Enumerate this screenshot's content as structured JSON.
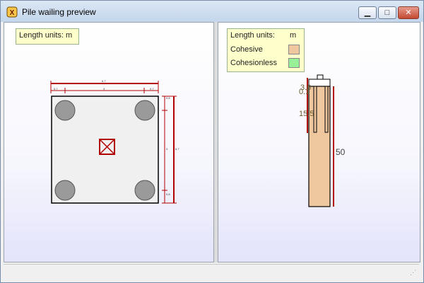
{
  "window": {
    "title": "Pile wailing preview",
    "icon": "app-logo-icon"
  },
  "controls": {
    "minimize_icon": "minimize-icon",
    "maximize_icon": "maximize-icon",
    "close_icon": "close-icon"
  },
  "plan_view": {
    "units_label": "Length units: m",
    "dims_top": [
      "0.7",
      "3",
      "0.7",
      "6.7"
    ],
    "dims_right": [
      "0.8",
      "3",
      "0.8",
      "6.7"
    ]
  },
  "section_view": {
    "legend": {
      "units_label": "Length units:",
      "units_value": "m",
      "items": [
        {
          "label": "Cohesive",
          "color": "#f0c8a0"
        },
        {
          "label": "Cohesionless",
          "color": "#98f098"
        }
      ]
    },
    "depth_labels": [
      "3.6",
      "0.1",
      "15.5"
    ],
    "pile_length_label": "50"
  },
  "colors": {
    "dimension_line": "#b00000",
    "cap_fill": "#f0f0f0",
    "pile_fill": "#9a9a9a",
    "soil_cohesive": "#f0c8a0"
  }
}
